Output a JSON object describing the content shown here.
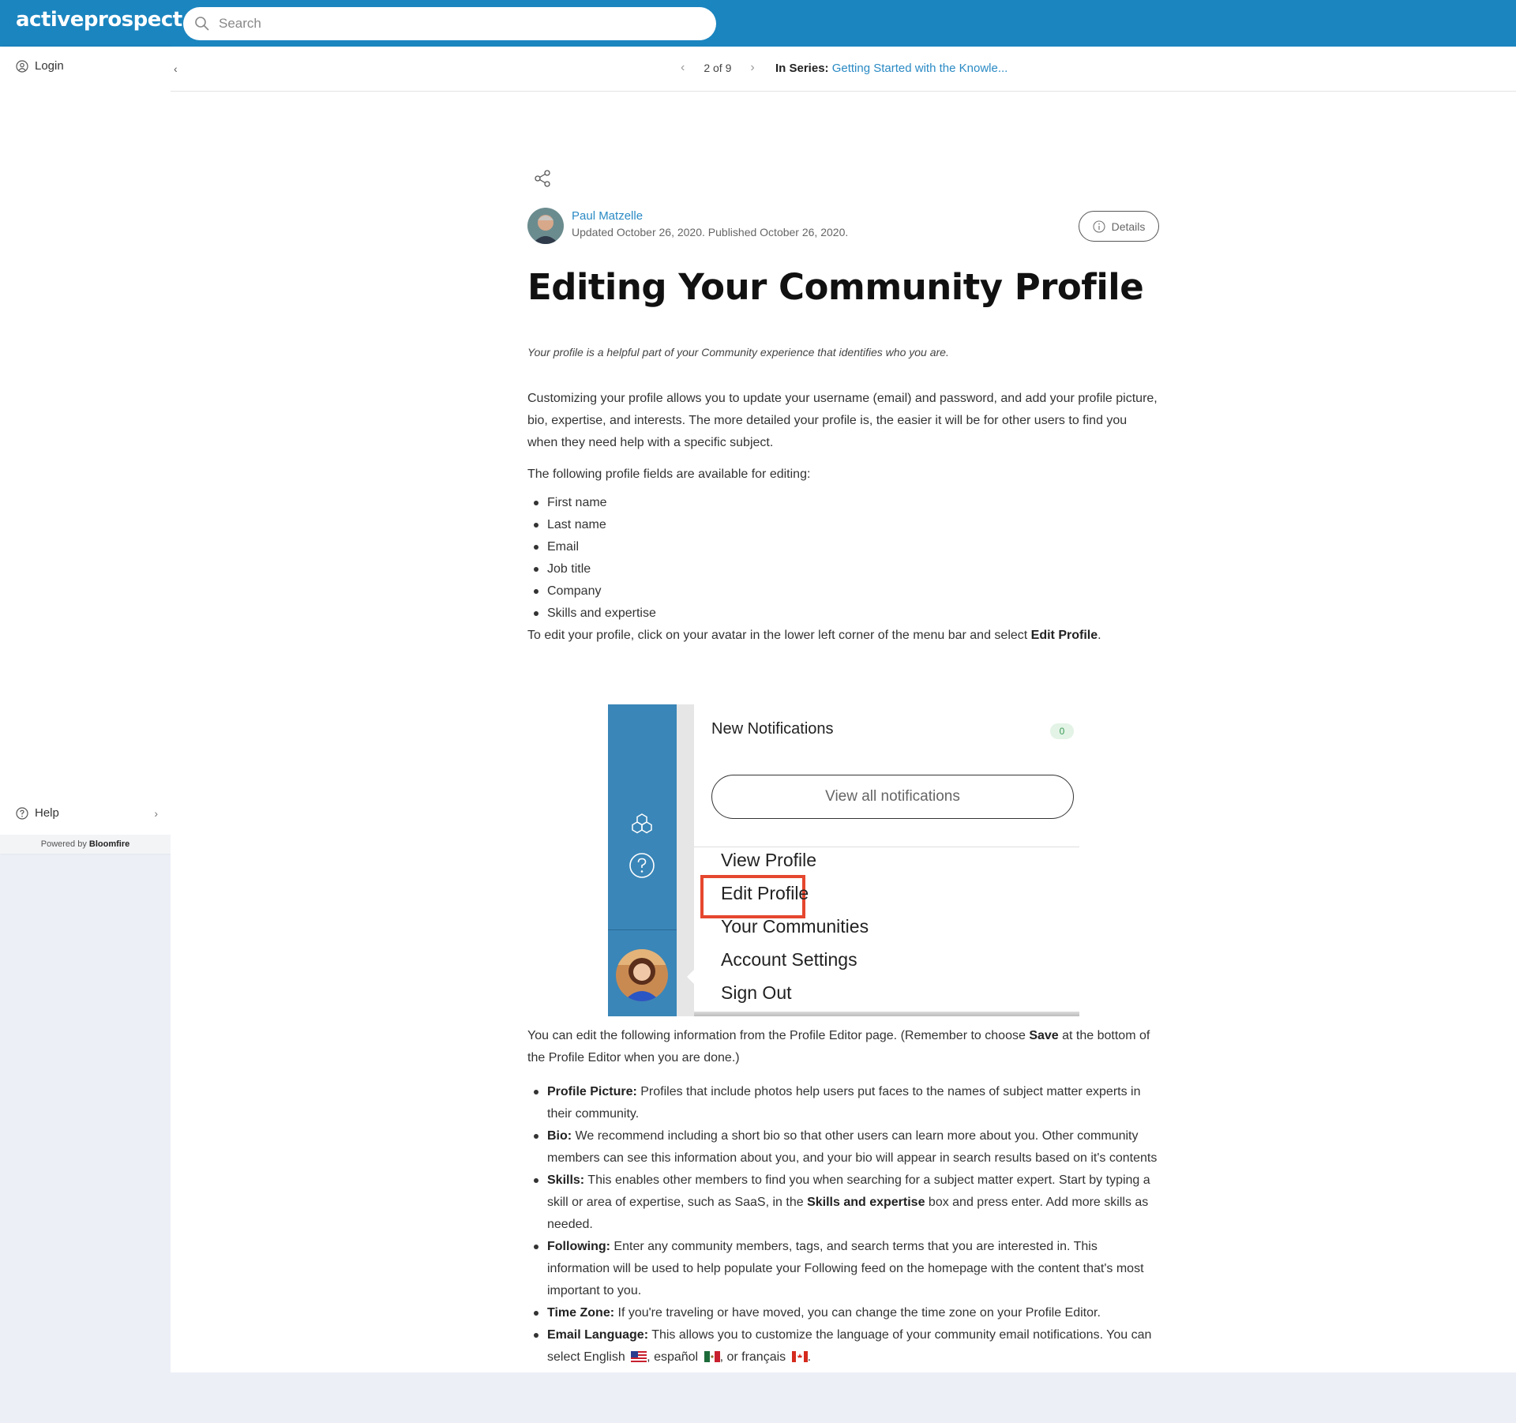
{
  "header": {
    "brand": "activeprospect",
    "search_placeholder": "Search",
    "brand_color": "#1b85bf"
  },
  "sidebar": {
    "login_label": "Login",
    "help_label": "Help",
    "powered_prefix": "Powered by",
    "powered_brand": "Bloomfire"
  },
  "series_bar": {
    "position": "2 of 9",
    "series_label": "In Series:",
    "series_name": "Getting Started with the Knowle..."
  },
  "article": {
    "author_name": "Paul Matzelle",
    "meta": "Updated October 26, 2020. Published October 26, 2020.",
    "details_label": "Details",
    "title": "Editing Your Community Profile",
    "lead": "Your profile is a helpful part of your Community experience that identifies who you are.",
    "intro": "Customizing your profile allows you to update your username (email) and password, and add your profile picture, bio, expertise, and interests. The more detailed your profile is, the easier it will be for other users to find you when they need help with a specific subject.",
    "fields_intro": "The following profile fields are available for editing:",
    "fields": [
      "First name",
      "Last name",
      "Email",
      "Job title",
      "Company",
      "Skills and expertise"
    ],
    "instruction_pre": "To edit your profile, click on your avatar in the lower left corner of the menu bar and select ",
    "instruction_bold": "Edit Profile",
    "instruction_post": ".",
    "editor_pre": "You can edit the following information from the Profile Editor page. (Remember to choose ",
    "editor_bold": "Save",
    "editor_post": " at the bottom of the Profile Editor when you are done.)",
    "details": [
      {
        "term": "Profile Picture:",
        "text": " Profiles that include photos help users put faces to the names of subject matter experts in their community."
      },
      {
        "term": "Bio:",
        "text": " We recommend including a short bio so that other users can learn more about you. Other community members can see this information about you, and your bio will appear in search results based on it's contents"
      },
      {
        "term": "Skills:",
        "text_pre": " This enables other members to find you when searching for a subject matter expert. Start by typing a skill or area of expertise, such as SaaS, in the ",
        "bold": "Skills and expertise",
        "text_post": " box and press enter. Add more skills as needed."
      },
      {
        "term": "Following:",
        "text": " Enter any community members, tags, and search terms that you are interested in. This information will be used to help populate your Following feed on the homepage with the content that's most important to you."
      },
      {
        "term": "Time Zone:",
        "text": " If you're traveling or have moved, you can change the time zone on your Profile Editor."
      },
      {
        "term": "Email Language:",
        "text_pre": " This allows you to customize the language of your community email notifications. You can select English",
        "lang2": ", español",
        "lang3": ", or français",
        "end": "."
      }
    ]
  },
  "screenshot": {
    "notif_title": "New Notifications",
    "notif_count": "0",
    "view_all": "View all notifications",
    "menu": [
      "View Profile",
      "Edit Profile",
      "Your Communities",
      "Account Settings",
      "Sign Out"
    ],
    "highlight_color": "#e5472e",
    "rail_color": "#3a86b8"
  }
}
